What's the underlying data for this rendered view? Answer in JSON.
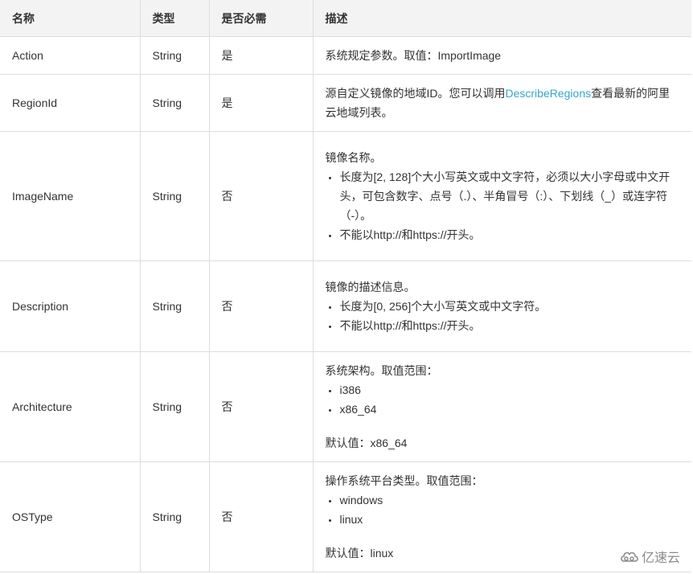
{
  "table": {
    "headers": {
      "name": "名称",
      "type": "类型",
      "required": "是否必需",
      "description": "描述"
    },
    "rows": [
      {
        "name": "Action",
        "type": "String",
        "required": "是",
        "desc_text": "系统规定参数。取值：ImportImage"
      },
      {
        "name": "RegionId",
        "type": "String",
        "required": "是",
        "desc_before": "源自定义镜像的地域ID。您可以调用",
        "desc_link": "DescribeRegions",
        "desc_after": "查看最新的阿里云地域列表。"
      },
      {
        "name": "ImageName",
        "type": "String",
        "required": "否",
        "desc_intro": "镜像名称。",
        "bullets": [
          "长度为[2, 128]个大小写英文或中文字符，必须以大小字母或中文开头，可包含数字、点号（.）、半角冒号（:）、下划线（_）或连字符（-）。",
          "不能以http://和https://开头。"
        ]
      },
      {
        "name": "Description",
        "type": "String",
        "required": "否",
        "desc_intro": "镜像的描述信息。",
        "bullets": [
          "长度为[0, 256]个大小写英文或中文字符。",
          "不能以http://和https://开头。"
        ]
      },
      {
        "name": "Architecture",
        "type": "String",
        "required": "否",
        "desc_intro": "系统架构。取值范围：",
        "bullets": [
          "i386",
          "x86_64"
        ],
        "default": "默认值：x86_64"
      },
      {
        "name": "OSType",
        "type": "String",
        "required": "否",
        "desc_intro": "操作系统平台类型。取值范围：",
        "bullets": [
          "windows",
          "linux"
        ],
        "default": "默认值：linux"
      }
    ]
  },
  "watermark": {
    "icon": "cloud-logo-icon",
    "text": "亿速云"
  },
  "colors": {
    "link": "#33a6cc",
    "header_bg": "#f3f3f3",
    "border": "#dddddd",
    "text": "#333333"
  }
}
